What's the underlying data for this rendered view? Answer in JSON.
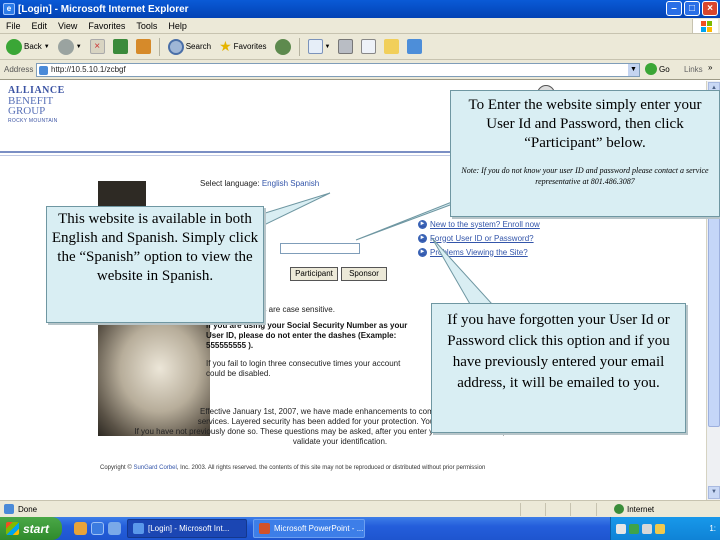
{
  "window": {
    "title": "[Login] - Microsoft Internet Explorer"
  },
  "menu": [
    "File",
    "Edit",
    "View",
    "Favorites",
    "Tools",
    "Help"
  ],
  "toolbar": {
    "back_label": "Back",
    "search_label": "Search",
    "favorites_label": "Favorites"
  },
  "address": {
    "label": "Address",
    "url": "http://10.5.10.1/zcbgf",
    "go_label": "Go",
    "links_label": "Links",
    "more": "»"
  },
  "page": {
    "logo": {
      "line1": "ALLIANCE",
      "line2": "BENEFIT",
      "line3": "GROUP",
      "line4": "ROCKY MOUNTAIN"
    },
    "select_language_label": "Select language:",
    "language_options": "English Spanish",
    "participant_button": "Participant",
    "sponsor_button": "Sponsor",
    "case_note": "es are case sensitive.",
    "ssn_note": "If you are using your Social Security Number as your User ID, please do not enter the dashes (Example: 555555555 ).",
    "lock_note": "If you fail to login three consecutive times your account could be disabled.",
    "help_links": [
      "New to the system? Enroll now",
      "Forgot User ID or Password?",
      "Problems Viewing the Site?"
    ],
    "efti_line1": "Effective January 1st, 2007, we have made enhancements to comply with EFTI",
    "efti_line2": "services. Layered security has been added for your protection. You will be asked",
    "efti_line3": "If you have not previously done so. These questions may be asked, after you enter your user name and password to",
    "efti_line4": "validate your identification.",
    "copyright_prefix": "Copyright ©",
    "copyright_link": "SunGard Corbel",
    "copyright_rest": ", Inc. 2003. All rights reserved. the contents of this site may not be reproduced or distributed without prior permission"
  },
  "callouts": {
    "top_main": "To Enter the website simply enter your User Id and Password, then click “Participant” below.",
    "top_small": "Note: If you do not know your user ID and password please contact a service representative at 801.486.3087",
    "left_main": "This website is available in both English and Spanish. Simply click the “Spanish” option to view the website in Spanish.",
    "right_main": "If you have forgotten your User Id or Password click this option and if you have previously entered your email address, it will be emailed to you."
  },
  "status": {
    "text": "Done",
    "zone": "Internet"
  },
  "taskbar": {
    "start_label": "start",
    "task1": "[Login] - Microsoft Int...",
    "task2": "Microsoft PowerPoint - ...",
    "clock": "1:"
  },
  "colors": {
    "callout_fill": "#d9eef3",
    "callout_border": "#6f97a2",
    "link_blue": "#3355aa",
    "titlebar_blue": "#0a5ad6"
  }
}
